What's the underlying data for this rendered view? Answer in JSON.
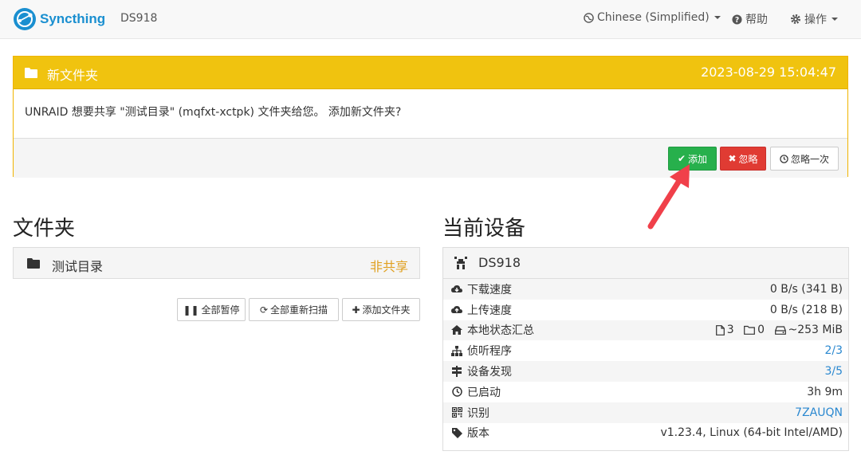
{
  "navbar": {
    "brand": "Syncthing",
    "device": "DS918",
    "language": "Chinese (Simplified)",
    "help": "帮助",
    "actions": "操作"
  },
  "notification": {
    "title": "新文件夹",
    "date": "2023-08-29 15:04:47",
    "message": "UNRAID 想要共享 \"测试目录\" (mqfxt-xctpk) 文件夹给您。 添加新文件夹?",
    "add_label": "添加",
    "ignore_label": "忽略",
    "later_label": "忽略一次"
  },
  "folders": {
    "heading": "文件夹",
    "items": [
      {
        "name": "测试目录",
        "status": "非共享"
      }
    ],
    "pause_all": "全部暂停",
    "rescan_all": "全部重新扫描",
    "add_folder": "添加文件夹"
  },
  "device": {
    "heading": "当前设备",
    "name": "DS918",
    "rows": [
      {
        "label": "下载速度",
        "value": "0 B/s (341 B)",
        "icon": "cloud-download-icon"
      },
      {
        "label": "上传速度",
        "value": "0 B/s (218 B)",
        "icon": "cloud-upload-icon"
      },
      {
        "label": "本地状态汇总",
        "files": "3",
        "dirs": "0",
        "size": "~253 MiB",
        "icon": "home-icon"
      },
      {
        "label": "侦听程序",
        "value": "2/3",
        "icon": "sitemap-icon"
      },
      {
        "label": "设备发现",
        "value": "3/5",
        "icon": "signpost-icon"
      },
      {
        "label": "已启动",
        "value": "3h 9m",
        "icon": "clock-icon"
      },
      {
        "label": "识别",
        "value": "7ZAUQN",
        "icon": "qrcode-icon"
      },
      {
        "label": "版本",
        "value": "v1.23.4, Linux (64-bit Intel/AMD)",
        "icon": "tag-icon"
      }
    ]
  },
  "colors": {
    "brand": "#1a8fd0",
    "warning": "#f0c30f",
    "success": "#27b04c",
    "danger": "#e03b33",
    "unshared": "#e0a020",
    "arrow": "#f0404a"
  }
}
